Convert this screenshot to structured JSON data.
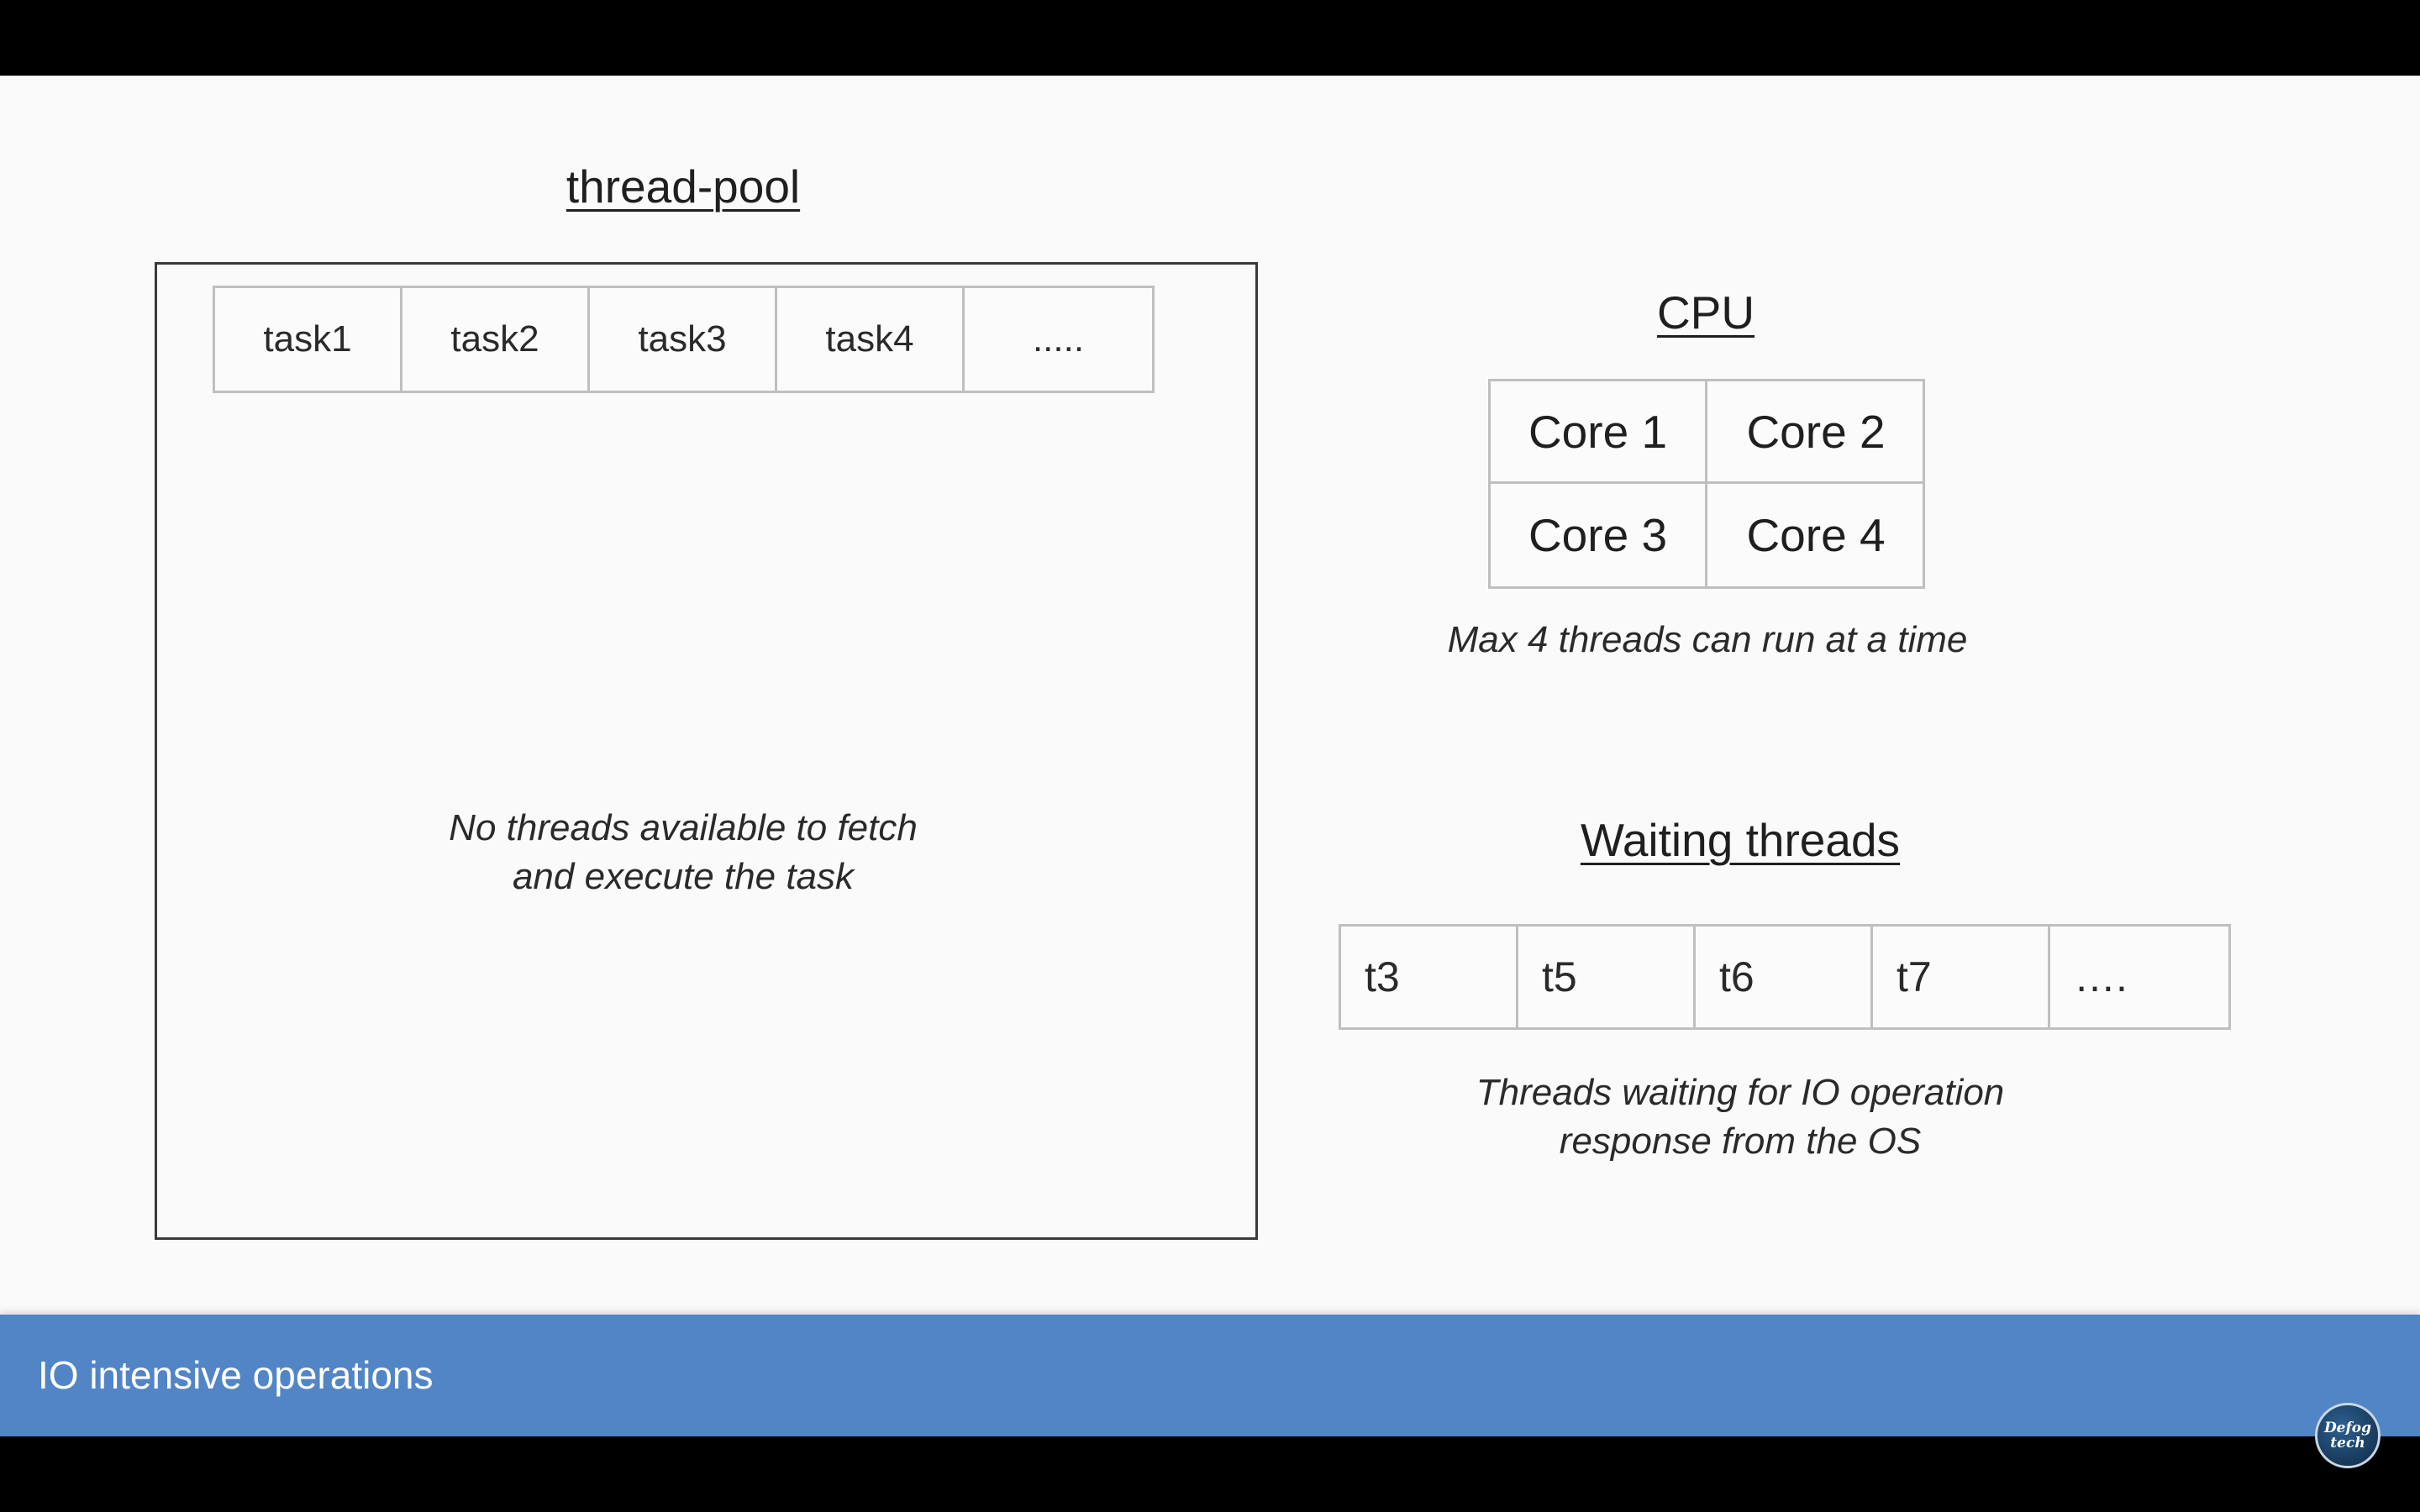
{
  "thread_pool": {
    "heading": "thread-pool",
    "tasks": [
      "task1",
      "task2",
      "task3",
      "task4",
      "....."
    ],
    "note_line1": "No threads available to fetch",
    "note_line2": "and execute the task"
  },
  "cpu": {
    "heading": "CPU",
    "cores": [
      "Core 1",
      "Core 2",
      "Core 3",
      "Core 4"
    ],
    "note": "Max 4 threads can run at a time"
  },
  "waiting": {
    "heading": "Waiting threads",
    "threads": [
      "t3",
      "t5",
      "t6",
      "t7",
      "…."
    ],
    "note_line1": "Threads waiting for IO operation",
    "note_line2": "response from the OS"
  },
  "footer": {
    "title": "IO intensive operations",
    "logo_line1": "Defog",
    "logo_line2": "tech"
  },
  "colors": {
    "bar": "#5185c6",
    "background": "#fafafa"
  }
}
